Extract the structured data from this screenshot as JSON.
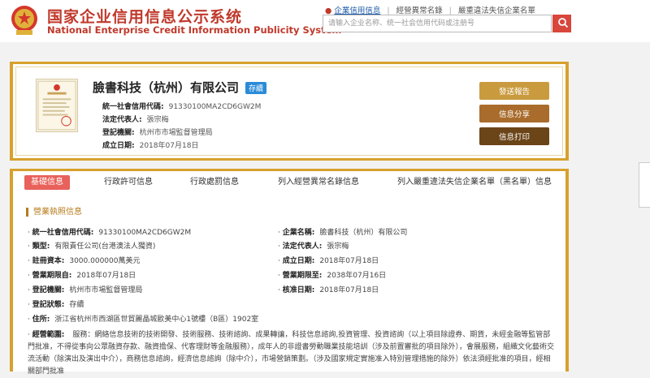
{
  "header": {
    "title_cn": "国家企业信用信息公示系统",
    "title_en": "National Enterprise Credit Information Publicity System",
    "nav": [
      "企業信用信息",
      "經營異常名錄",
      "嚴重違法失信企業名單"
    ],
    "search_placeholder": "请输入企业名称、统一社会信用代码或注册号"
  },
  "company": {
    "name": "臉書科技（杭州）有限公司",
    "status": "存續",
    "rows": [
      {
        "label": "統一社會信用代碼:",
        "value": "91330100MA2CD6GW2M"
      },
      {
        "label": "法定代表人:",
        "value": "張宗梅"
      },
      {
        "label": "登記機關:",
        "value": "杭州市市場監督管理局"
      },
      {
        "label": "成立日期:",
        "value": "2018年07月18日"
      }
    ],
    "buttons": [
      "發送報告",
      "信息分享",
      "信息打印"
    ]
  },
  "tabs": [
    "基礎信息",
    "行政許可信息",
    "行政處罰信息",
    "列入經營異常名錄信息",
    "列入嚴重違法失信企業名單（黑名單）信息"
  ],
  "section": {
    "title": "營業執照信息",
    "left": [
      {
        "label": "統一社會信用代碼:",
        "value": "91330100MA2CD6GW2M"
      },
      {
        "label": "類型:",
        "value": "有限責任公司(台港澳法人獨資)"
      },
      {
        "label": "註冊資本:",
        "value": "3000.000000萬美元"
      },
      {
        "label": "營業期限自:",
        "value": "2018年07月18日"
      },
      {
        "label": "登記機關:",
        "value": "杭州市市場監督管理局"
      },
      {
        "label": "登記狀態:",
        "value": "存續"
      }
    ],
    "right": [
      {
        "label": "企業名稱:",
        "value": "臉書科技（杭州）有限公司"
      },
      {
        "label": "法定代表人:",
        "value": "張宗梅"
      },
      {
        "label": "成立日期:",
        "value": "2018年07月18日"
      },
      {
        "label": "營業期限至:",
        "value": "2038年07月16日"
      },
      {
        "label": "核准日期:",
        "value": "2018年07月18日"
      }
    ],
    "address": {
      "label": "住所:",
      "value": "浙江省杭州市西湖區世貿麗晶城歐美中心1號樓（B區）1902室"
    },
    "scope": {
      "label": "經營範圍:",
      "value": "服務：網絡信息技術的技術開發、技術服務、技術諮詢、成果轉讓，科技信息諮詢,投資管理、投資諮詢（以上項目除證券、期貨，未經金融等監管部門批准，不得從事向公眾融資存款、融資擔保、代客理財等金融服務），成年人的非證書勞動職業技能培訓（涉及前置審批的項目除外），會展服務，組織文化藝術交流活動（除演出及演出中介），商務信息諮詢，經濟信息諮詢（除中介），市場營銷策劃。（涉及國家規定實施准入特別管理措施的除外）依法須經批准的項目，經相關部門批准"
    }
  }
}
